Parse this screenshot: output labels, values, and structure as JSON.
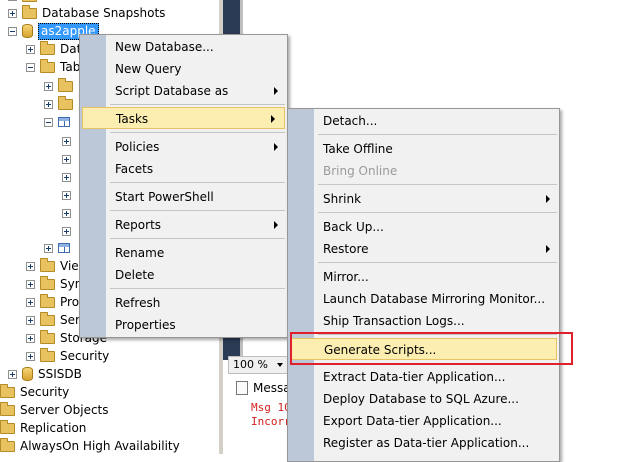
{
  "tree": {
    "database_snapshots": "Database Snapshots",
    "selected_db": "as2apple",
    "db_child_1": "Dat",
    "tables_partial": "Tab",
    "views_partial": "Vie",
    "synonyms_partial": "Syn",
    "programmability_partial": "Pro",
    "service_broker_partial": "Ser",
    "storage": "Storage",
    "security_sub": "Security",
    "ssisdb": "SSISDB",
    "security": "Security",
    "server_objects": "Server Objects",
    "replication": "Replication",
    "alwayson": "AlwaysOn High Availability"
  },
  "results": {
    "zoom": "100 %",
    "messages_tab": "Messa",
    "msg_line1": "Msg 10",
    "msg_line2": "Incorr"
  },
  "context_menu": {
    "new_database": "New Database...",
    "new_query": "New Query",
    "script_database_as": "Script Database as",
    "tasks": "Tasks",
    "policies": "Policies",
    "facets": "Facets",
    "start_powershell": "Start PowerShell",
    "reports": "Reports",
    "rename": "Rename",
    "delete": "Delete",
    "refresh": "Refresh",
    "properties": "Properties"
  },
  "tasks_menu": {
    "detach": "Detach...",
    "take_offline": "Take Offline",
    "bring_online": "Bring Online",
    "shrink": "Shrink",
    "back_up": "Back Up...",
    "restore": "Restore",
    "mirror": "Mirror...",
    "launch_mirroring_monitor": "Launch Database Mirroring Monitor...",
    "ship_transaction_logs": "Ship Transaction Logs...",
    "generate_scripts": "Generate Scripts...",
    "extract_data_tier": "Extract Data-tier Application...",
    "deploy_sql_azure": "Deploy Database to SQL Azure...",
    "export_data_tier": "Export Data-tier Application...",
    "register_data_tier": "Register as Data-tier Application..."
  },
  "colors": {
    "highlight_box": "#e0202a",
    "menu_highlight": "#fceeb0",
    "selection": "#3399ff"
  }
}
